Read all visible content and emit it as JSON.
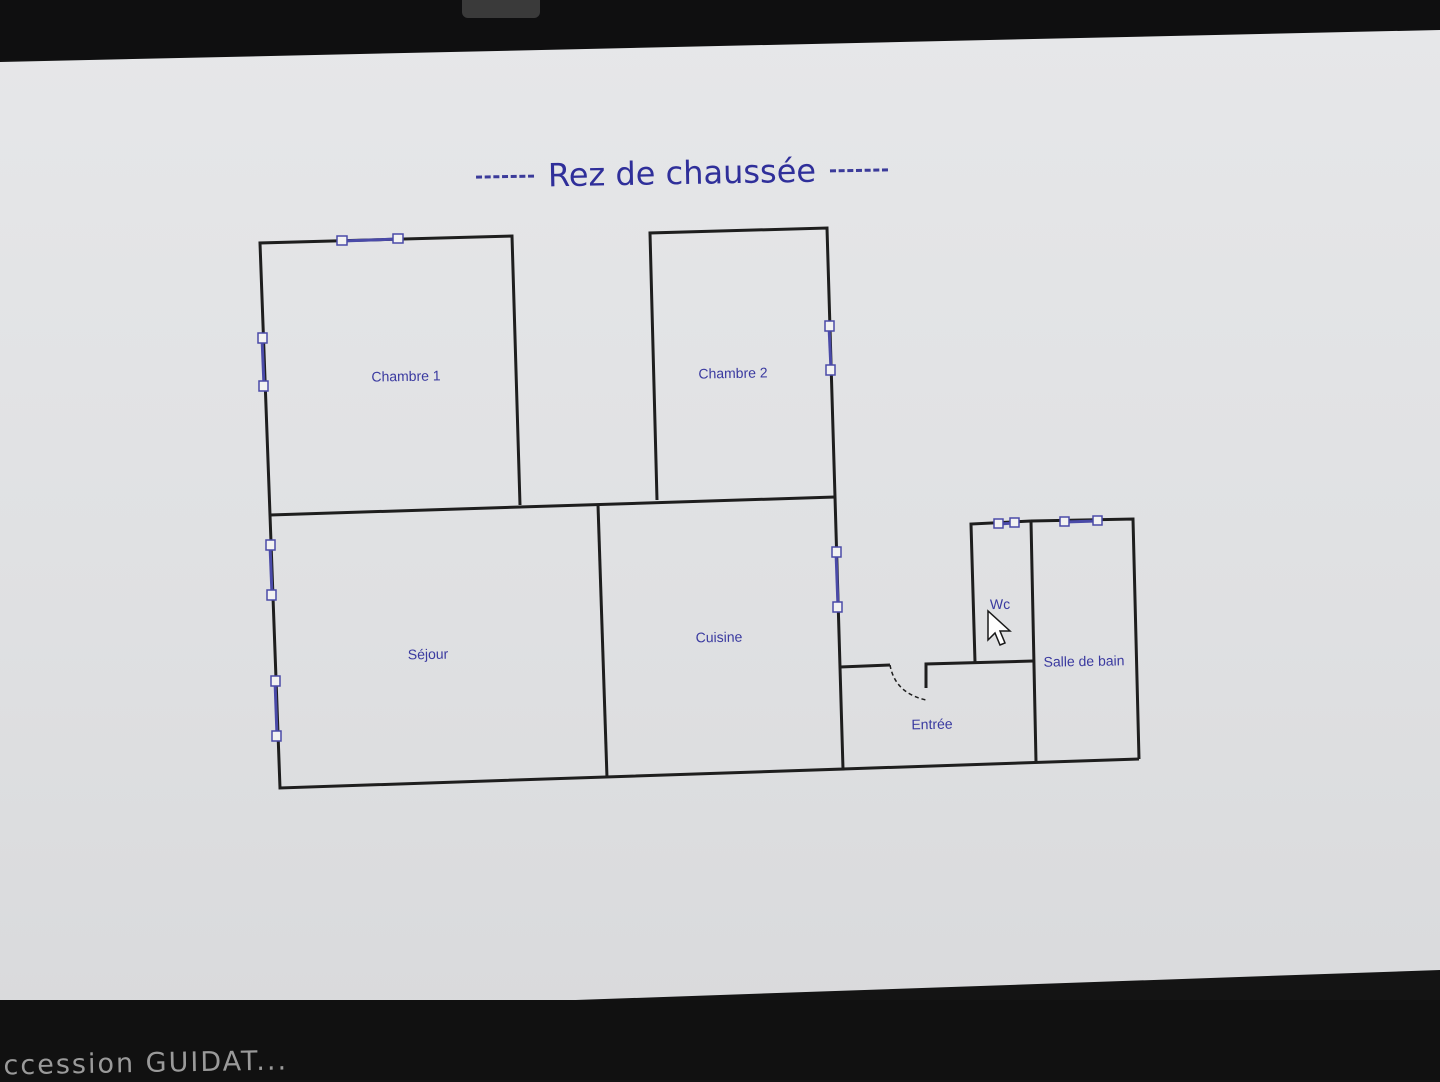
{
  "header": {
    "title": "Rez de chaussée"
  },
  "rooms": {
    "chambre1": "Chambre 1",
    "chambre2": "Chambre 2",
    "sejour": "Séjour",
    "cuisine": "Cuisine",
    "wc": "Wc",
    "salle_de_bain": "Salle de bain",
    "entree": "Entrée"
  },
  "footer": {
    "text": "ıccession  GUIDAT..."
  },
  "colors": {
    "wall": "#1e1e1e",
    "window": "#4a4aa8",
    "label": "#3a3aa0"
  },
  "icons": {
    "cursor": "mouse-pointer-icon"
  }
}
